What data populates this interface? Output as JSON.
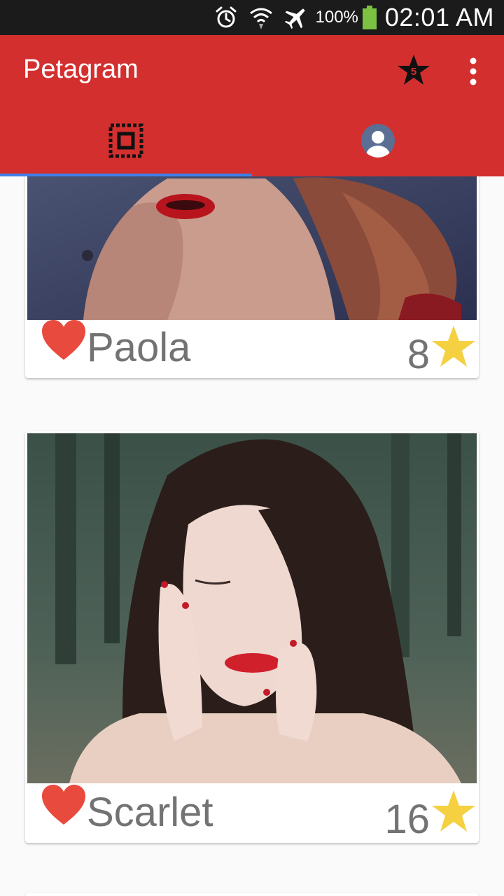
{
  "status_bar": {
    "battery_percent": "100%",
    "time": "02:01 AM",
    "icons": [
      "alarm-icon",
      "wifi-icon",
      "airplane-mode-icon",
      "battery-icon"
    ]
  },
  "app_bar": {
    "title": "Petagram",
    "favorites_badge_count": "5",
    "background_color": "#d32f2f",
    "actions": [
      "star-favorites-icon",
      "more-vert-icon"
    ]
  },
  "tabs": [
    {
      "icon": "grid-view-icon",
      "selected": true
    },
    {
      "icon": "profile-avatar-icon",
      "selected": false
    }
  ],
  "tab_indicator_color": "#3f7fe8",
  "pets": [
    {
      "name": "Paola",
      "rating": "8",
      "liked": true
    },
    {
      "name": "Scarlet",
      "rating": "16",
      "liked": true
    }
  ],
  "colors": {
    "heart": "#e84a3d",
    "star": "#f5d142",
    "name_text": "#737373"
  }
}
